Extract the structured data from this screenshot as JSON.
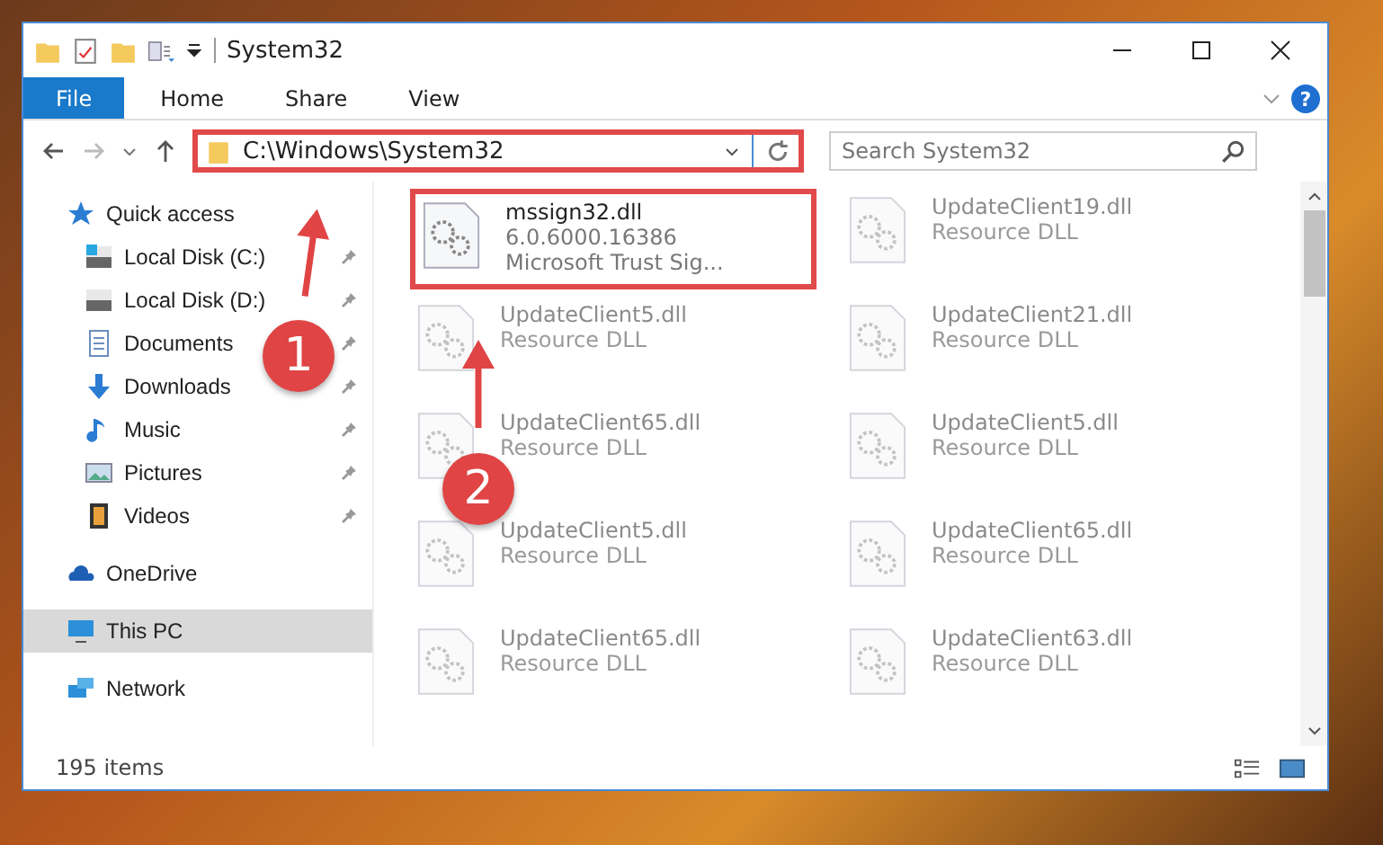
{
  "window": {
    "title": "System32"
  },
  "ribbon_tabs": [
    {
      "label": "File",
      "selected": true
    },
    {
      "label": "Home",
      "selected": false
    },
    {
      "label": "Share",
      "selected": false
    },
    {
      "label": "View",
      "selected": false
    }
  ],
  "address_bar": {
    "path": "C:\\Windows\\System32",
    "highlighted": true
  },
  "search": {
    "placeholder": "Search System32"
  },
  "help": {
    "symbol": "?"
  },
  "sidebar": {
    "items": [
      {
        "label": "Quick access",
        "kind": "star",
        "pinned": false,
        "selected": false,
        "children": [
          {
            "label": "Local Disk (C:)",
            "kind": "disk-c",
            "pinned": true,
            "selected": false
          },
          {
            "label": "Local Disk (D:)",
            "kind": "disk",
            "pinned": true,
            "selected": false
          },
          {
            "label": "Documents",
            "kind": "documents",
            "pinned": true,
            "selected": false
          },
          {
            "label": "Downloads",
            "kind": "downloads",
            "pinned": true,
            "selected": false
          },
          {
            "label": "Music",
            "kind": "music",
            "pinned": true,
            "selected": false
          },
          {
            "label": "Pictures",
            "kind": "pictures",
            "pinned": true,
            "selected": false
          },
          {
            "label": "Videos",
            "kind": "videos",
            "pinned": true,
            "selected": false
          }
        ]
      },
      {
        "label": "OneDrive",
        "kind": "cloud",
        "pinned": false,
        "selected": false
      },
      {
        "label": "This PC",
        "kind": "pc",
        "pinned": false,
        "selected": true
      },
      {
        "label": "Network",
        "kind": "network",
        "pinned": false,
        "selected": false
      }
    ]
  },
  "files": [
    {
      "name": "mssign32.dll",
      "lines": [
        "6.0.6000.16386",
        "Microsoft Trust Sig..."
      ],
      "blurred": false,
      "highlighted": true
    },
    {
      "name": "UpdateClient19.dll",
      "lines": [
        "Resource DLL"
      ],
      "blurred": true,
      "highlighted": false
    },
    {
      "name": "UpdateClient5.dll",
      "lines": [
        "Resource DLL"
      ],
      "blurred": true,
      "highlighted": false
    },
    {
      "name": "UpdateClient21.dll",
      "lines": [
        "Resource DLL"
      ],
      "blurred": true,
      "highlighted": false
    },
    {
      "name": "UpdateClient65.dll",
      "lines": [
        "Resource DLL"
      ],
      "blurred": true,
      "highlighted": false
    },
    {
      "name": "UpdateClient5.dll",
      "lines": [
        "Resource DLL"
      ],
      "blurred": true,
      "highlighted": false
    },
    {
      "name": "UpdateClient5.dll",
      "lines": [
        "Resource DLL"
      ],
      "blurred": true,
      "highlighted": false
    },
    {
      "name": "UpdateClient65.dll",
      "lines": [
        "Resource DLL"
      ],
      "blurred": true,
      "highlighted": false
    },
    {
      "name": "UpdateClient65.dll",
      "lines": [
        "Resource DLL"
      ],
      "blurred": true,
      "highlighted": false
    },
    {
      "name": "UpdateClient63.dll",
      "lines": [
        "Resource DLL"
      ],
      "blurred": true,
      "highlighted": false
    }
  ],
  "status_bar": {
    "count": "195 items"
  },
  "callouts": [
    {
      "number": "1"
    },
    {
      "number": "2"
    }
  ]
}
